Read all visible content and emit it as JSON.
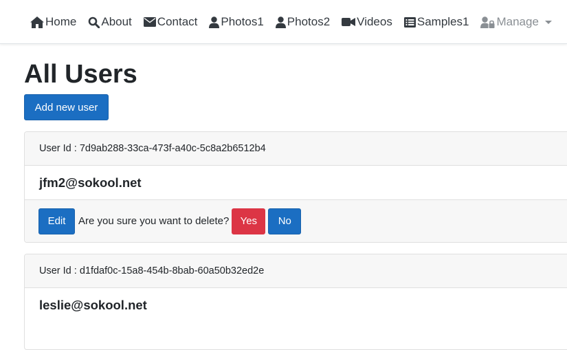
{
  "nav": {
    "items": [
      {
        "label": "Home",
        "icon": "home-icon"
      },
      {
        "label": "About",
        "icon": "search-icon"
      },
      {
        "label": "Contact",
        "icon": "envelope-icon"
      },
      {
        "label": "Photos1",
        "icon": "user-icon"
      },
      {
        "label": "Photos2",
        "icon": "user-icon"
      },
      {
        "label": "Videos",
        "icon": "video-icon"
      },
      {
        "label": "Samples1",
        "icon": "list-alt-icon"
      },
      {
        "label": "Manage",
        "icon": "user-lock-icon"
      }
    ]
  },
  "page": {
    "title": "All Users",
    "add_button": "Add new user"
  },
  "users": [
    {
      "id_label": "User Id : 7d9ab288-33ca-473f-a40c-5c8a2b6512b4",
      "email": "jfm2@sokool.net",
      "edit_label": "Edit",
      "confirm_text": "Are you sure you want to delete?",
      "yes_label": "Yes",
      "no_label": "No"
    },
    {
      "id_label": "User Id : d1fdaf0c-15a8-454b-8bab-60a50b32ed2e",
      "email": "leslie@sokool.net"
    }
  ],
  "colors": {
    "primary": "#1b6ec2",
    "danger": "#dc3545",
    "card_header_bg": "#f7f7f7",
    "nav_text": "#343a40",
    "nav_muted": "#8a8f94"
  }
}
